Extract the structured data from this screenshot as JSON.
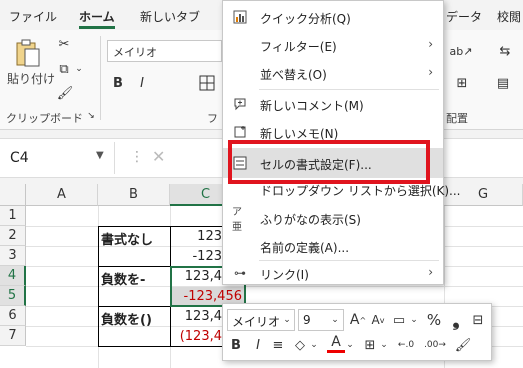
{
  "tabs": [
    {
      "label": "ファイル",
      "active": false
    },
    {
      "label": "ホーム",
      "active": true
    },
    {
      "label": "新しいタブ",
      "active": false
    },
    {
      "label": "データ",
      "active": false
    },
    {
      "label": "校閲",
      "active": false
    }
  ],
  "ribbon": {
    "paste_label": "貼り付け",
    "clipboard_group": "クリップボード",
    "font_group_partial": "フ",
    "align_group_partial": "配置",
    "font_name": "メイリオ",
    "bold": "B",
    "italic": "I"
  },
  "formula_bar": {
    "name_box": "C4",
    "fx_sep": "⋮",
    "cancel": "✕"
  },
  "columns": [
    "A",
    "B",
    "C",
    "G"
  ],
  "selected_column": "C",
  "rows": [
    "1",
    "2",
    "3",
    "4",
    "5",
    "6",
    "7"
  ],
  "selected_rows": [
    "4",
    "5"
  ],
  "cells": {
    "b2": "書式なし",
    "c2": "123",
    "c3": "-123",
    "b4": "負数を-",
    "c4": "123,4",
    "c5": "-123,456",
    "b6": "負数を()",
    "c6": "123,4",
    "c7": "(123,4"
  },
  "context_menu": [
    {
      "label": "クイック分析(Q)",
      "icon": "quick-analysis-icon",
      "submenu": false
    },
    {
      "label": "フィルター(E)",
      "icon": "",
      "submenu": true
    },
    {
      "label": "並べ替え(O)",
      "icon": "",
      "submenu": true
    },
    {
      "label": "新しいコメント(M)",
      "icon": "new-comment-icon",
      "submenu": false
    },
    {
      "label": "新しいメモ(N)",
      "icon": "new-note-icon",
      "submenu": false
    },
    {
      "label": "セルの書式設定(F)...",
      "icon": "format-cells-icon",
      "submenu": false
    },
    {
      "label": "ドロップダウン リストから選択(K)...",
      "icon": "",
      "submenu": false
    },
    {
      "label": "ふりがなの表示(S)",
      "icon": "phonetic-icon",
      "submenu": false
    },
    {
      "label": "名前の定義(A)...",
      "icon": "",
      "submenu": false
    },
    {
      "label": "リンク(I)",
      "icon": "link-icon",
      "submenu": true
    }
  ],
  "mini_toolbar": {
    "font": "メイリオ",
    "size": "9",
    "percent": "%",
    "comma": "❟",
    "bold": "B",
    "italic": "I"
  },
  "colors": {
    "accent": "#217346",
    "highlight_frame": "#e0141e",
    "negative_red": "#c00000"
  }
}
